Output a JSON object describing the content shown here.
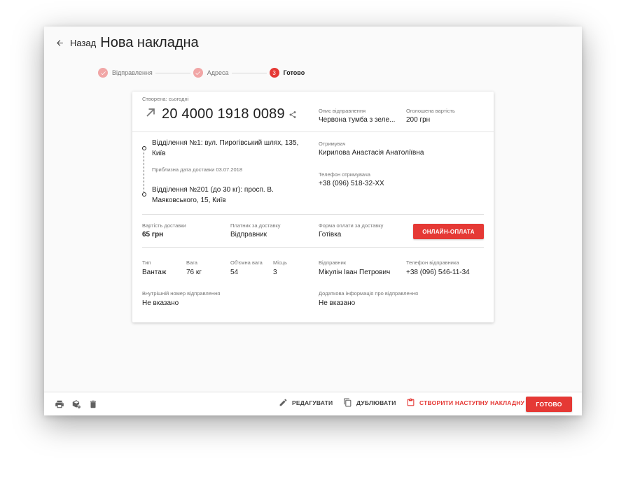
{
  "header": {
    "back_label": "Назад",
    "title": "Нова накладна"
  },
  "stepper": {
    "steps": [
      {
        "label": "Відправлення",
        "state": "done"
      },
      {
        "label": "Адреса",
        "state": "done"
      },
      {
        "label": "Готово",
        "state": "active",
        "number": "3"
      }
    ]
  },
  "card": {
    "created_label": "Створена: сьогодні",
    "ttn_number": "20 4000 1918 0089",
    "description_label": "Опис відправлення",
    "description_value": "Червона тумба з зеле...",
    "declared_value_label": "Оголошена вартість",
    "declared_value": "200 грн",
    "route": {
      "from": "Відділення №1: вул. Пирогівський шлях, 135, Київ",
      "delivery_date": "Приблизна дата доставки 03.07.2018",
      "to": "Відділення №201 (до 30 кг): просп. В. Маяковського, 15, Київ"
    },
    "recipient_label": "Отримувач",
    "recipient_value": "Кирилова Анастасія Анатоліївна",
    "recipient_phone_label": "Телефон отримувача",
    "recipient_phone_value": "+38 (096) 518-32-XX",
    "delivery_cost_label": "Вартість доставки",
    "delivery_cost_value": "65 грн",
    "payer_label": "Платник за доставку",
    "payer_value": "Відправник",
    "payment_form_label": "Форма оплати за доставку",
    "payment_form_value": "Готівка",
    "online_payment_button": "ОНЛАЙН-ОПЛАТА",
    "type_label": "Тип",
    "type_value": "Вантаж",
    "weight_label": "Вага",
    "weight_value": "76 кг",
    "volume_label": "Об'ємна вага",
    "volume_value": "54",
    "places_label": "Місць",
    "places_value": "3",
    "sender_label": "Відправник",
    "sender_value": "Мікулін Іван Петрович",
    "sender_phone_label": "Телефон відправника",
    "sender_phone_value": "+38 (096) 546-11-34",
    "internal_number_label": "Внутрішній номер відправлення",
    "internal_number_value": "Не вказано",
    "additional_info_label": "Додаткова інформація про відправлення",
    "additional_info_value": "Не вказано"
  },
  "bottom_bar": {
    "edit_label": "РЕДАГУВАТИ",
    "duplicate_label": "ДУБЛЮВАТИ",
    "create_next_label": "СТВОРИТИ НАСТУПНУ НАКЛАДНУ",
    "done_label": "ГОТОВО"
  },
  "colors": {
    "accent": "#e53935",
    "step_done": "#f1a6a6"
  }
}
